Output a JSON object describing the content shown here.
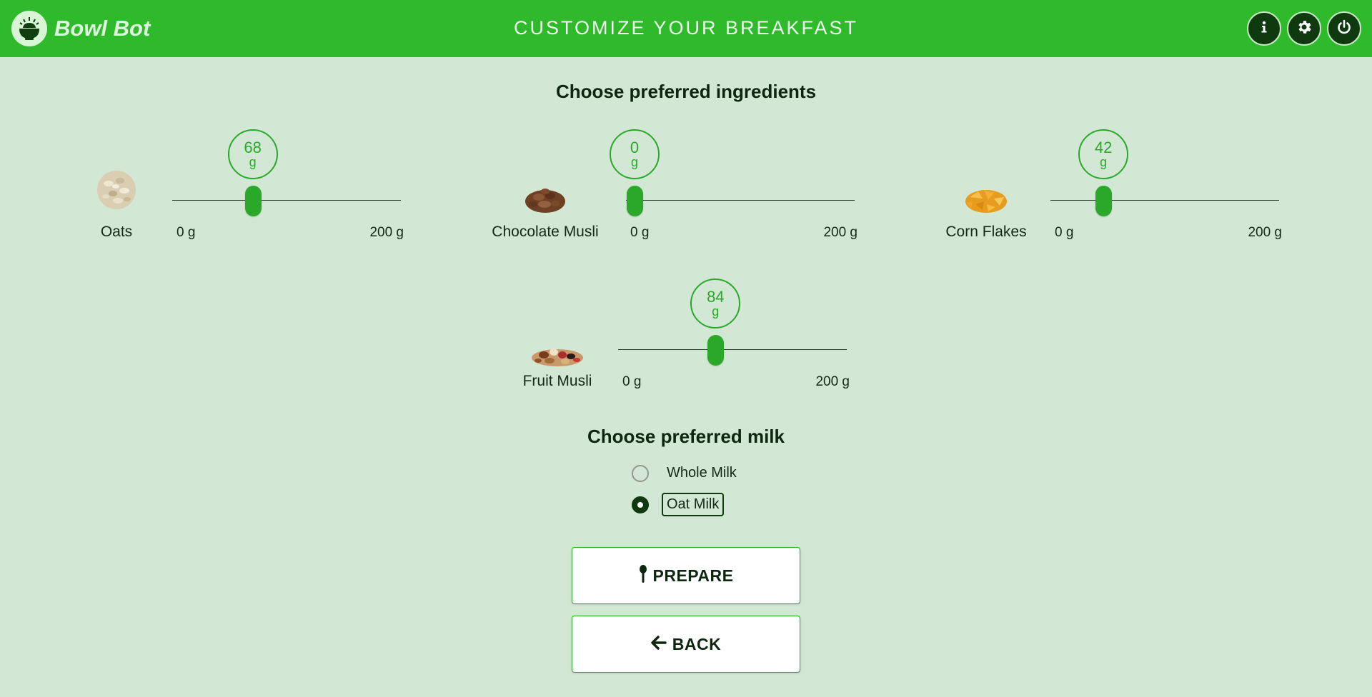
{
  "header": {
    "app_name": "Bowl Bot",
    "title": "CUSTOMIZE YOUR BREAKFAST",
    "actions": [
      {
        "name": "info",
        "icon": "info-icon"
      },
      {
        "name": "settings",
        "icon": "gear-icon"
      },
      {
        "name": "power",
        "icon": "power-icon"
      }
    ]
  },
  "ingredients_section": {
    "title": "Choose preferred ingredients",
    "items": [
      {
        "name": "Oats",
        "value": "68",
        "unit": "g",
        "min_label": "0 g",
        "max_label": "200 g",
        "min": 0,
        "max": 200,
        "icon": "oats-image"
      },
      {
        "name": "Chocolate Musli",
        "value": "0",
        "unit": "g",
        "min_label": "0 g",
        "max_label": "200 g",
        "min": 0,
        "max": 200,
        "icon": "chocolate-musli-image"
      },
      {
        "name": "Corn Flakes",
        "value": "42",
        "unit": "g",
        "min_label": "0 g",
        "max_label": "200 g",
        "min": 0,
        "max": 200,
        "icon": "corn-flakes-image"
      },
      {
        "name": "Fruit Musli",
        "value": "84",
        "unit": "g",
        "min_label": "0 g",
        "max_label": "200 g",
        "min": 0,
        "max": 200,
        "icon": "fruit-musli-image"
      }
    ]
  },
  "milk_section": {
    "title": "Choose preferred milk",
    "options": [
      {
        "label": "Whole Milk",
        "selected": false
      },
      {
        "label": "Oat Milk",
        "selected": true
      }
    ]
  },
  "buttons": {
    "prepare_label": "PREPARE",
    "back_label": "BACK"
  },
  "colors": {
    "header_bg": "#2fba2c",
    "page_bg": "#d3e8d4",
    "accent": "#2aa82a",
    "dark": "#0f3a10"
  }
}
